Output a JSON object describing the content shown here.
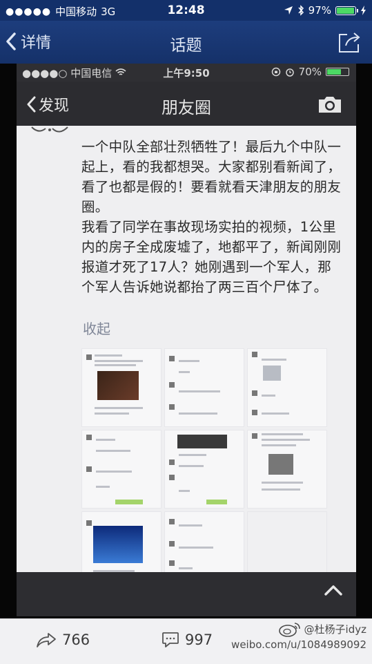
{
  "status_bar": {
    "carrier": "中国移动",
    "network": "3G",
    "time": "12:48",
    "battery": "97%",
    "battery_level": 0.97
  },
  "nav": {
    "back_label": "详情",
    "title": "话题"
  },
  "screenshot": {
    "status_bar": {
      "carrier": "中国电信",
      "time": "上午9:50",
      "battery": "70%",
      "battery_level": 0.7
    },
    "nav": {
      "back_label": "发现",
      "title": "朋友圈"
    },
    "post": {
      "paragraph1": "一个中队全部壮烈牺牲了！最后九个中队一起上，看的我都想哭。大家都别看新闻了，看了也都是假的！要看就看天津朋友的朋友圈。",
      "paragraph2": "我看了同学在事故现场实拍的视频，1公里内的房子全成废墟了，地都平了，新闻刚刚报道才死了17人？她刚遇到一个军人，那个军人告诉她说都抬了两三百个尸体了。",
      "collapse_label": "收起"
    }
  },
  "toolbar": {
    "repost_count": "766",
    "comment_count": "997"
  },
  "watermark": {
    "user": "@杜杨子idyz",
    "url": "weibo.com/u/1084989092"
  },
  "colors": {
    "nav_bg": "#153169",
    "link_text": "#7f8697",
    "battery_green": "#4cd964"
  }
}
